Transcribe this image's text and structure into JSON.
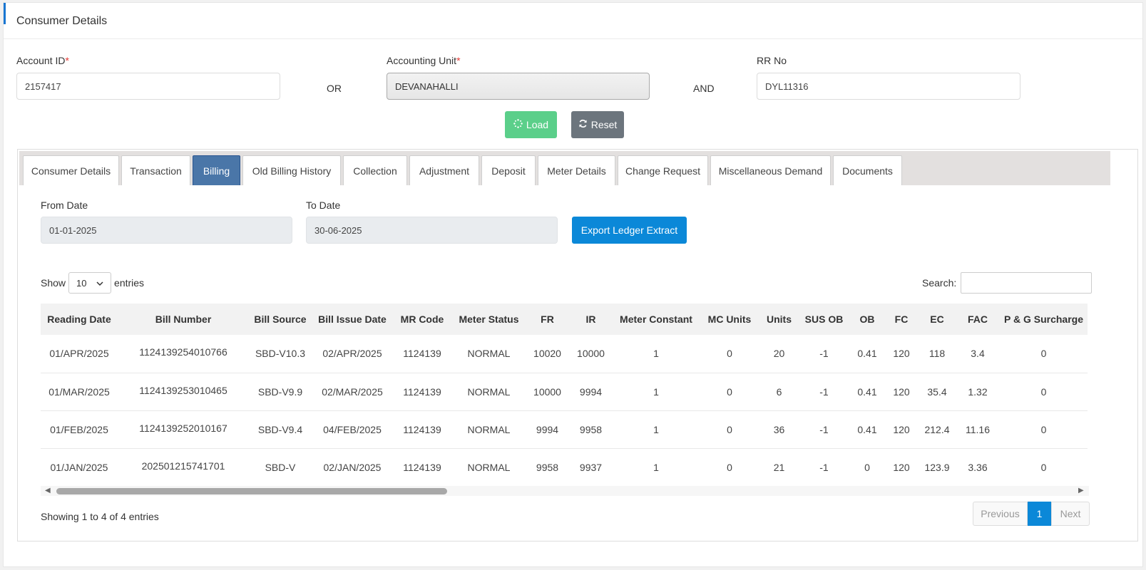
{
  "page": {
    "title": "Consumer Details"
  },
  "form": {
    "account_label": "Account ID",
    "account_value": "2157417",
    "or_text": "OR",
    "unit_label": "Accounting Unit",
    "unit_value": "DEVANAHALLI",
    "and_text": "AND",
    "rr_label": "RR No",
    "rr_value": "DYL11316",
    "required_mark": "*",
    "load_label": "Load",
    "reset_label": "Reset"
  },
  "tabs": [
    "Consumer Details",
    "Transaction",
    "Billing",
    "Old Billing History",
    "Collection",
    "Adjustment",
    "Deposit",
    "Meter Details",
    "Change Request",
    "Miscellaneous Demand",
    "Documents"
  ],
  "active_tab": "Billing",
  "billing": {
    "from_label": "From Date",
    "from_value": "01-01-2025",
    "to_label": "To Date",
    "to_value": "30-06-2025",
    "export_label": "Export Ledger Extract",
    "show_label": "Show",
    "entries_label": "entries",
    "page_length": "10",
    "search_label": "Search:",
    "columns": [
      "Reading Date",
      "Bill Number",
      "Bill Source",
      "Bill Issue Date",
      "MR Code",
      "Meter Status",
      "FR",
      "IR",
      "Meter Constant",
      "MC Units",
      "Units",
      "SUS OB",
      "OB",
      "FC",
      "EC",
      "FAC",
      "P & G Surcharge"
    ],
    "rows": [
      [
        "01/APR/2025",
        "1124139254010766",
        "SBD-V10.3",
        "02/APR/2025",
        "1124139",
        "NORMAL",
        "10020",
        "10000",
        "1",
        "0",
        "20",
        "-1",
        "0.41",
        "120",
        "118",
        "3.4",
        "0"
      ],
      [
        "01/MAR/2025",
        "1124139253010465",
        "SBD-V9.9",
        "02/MAR/2025",
        "1124139",
        "NORMAL",
        "10000",
        "9994",
        "1",
        "0",
        "6",
        "-1",
        "0.41",
        "120",
        "35.4",
        "1.32",
        "0"
      ],
      [
        "01/FEB/2025",
        "1124139252010167",
        "SBD-V9.4",
        "04/FEB/2025",
        "1124139",
        "NORMAL",
        "9994",
        "9958",
        "1",
        "0",
        "36",
        "-1",
        "0.41",
        "120",
        "212.4",
        "11.16",
        "0"
      ],
      [
        "01/JAN/2025",
        "202501215741701",
        "SBD-V",
        "02/JAN/2025",
        "1124139",
        "NORMAL",
        "9958",
        "9937",
        "1",
        "0",
        "21",
        "-1",
        "0",
        "120",
        "123.9",
        "3.36",
        "0"
      ]
    ],
    "info": "Showing 1 to 4 of 4 entries",
    "prev_label": "Previous",
    "page_number": "1",
    "next_label": "Next"
  },
  "colors": {
    "accent": "#1976d2",
    "active_tab": "#4a76a8",
    "load": "#5bcf8a",
    "reset": "#6c757d",
    "export": "#0b88d8"
  }
}
